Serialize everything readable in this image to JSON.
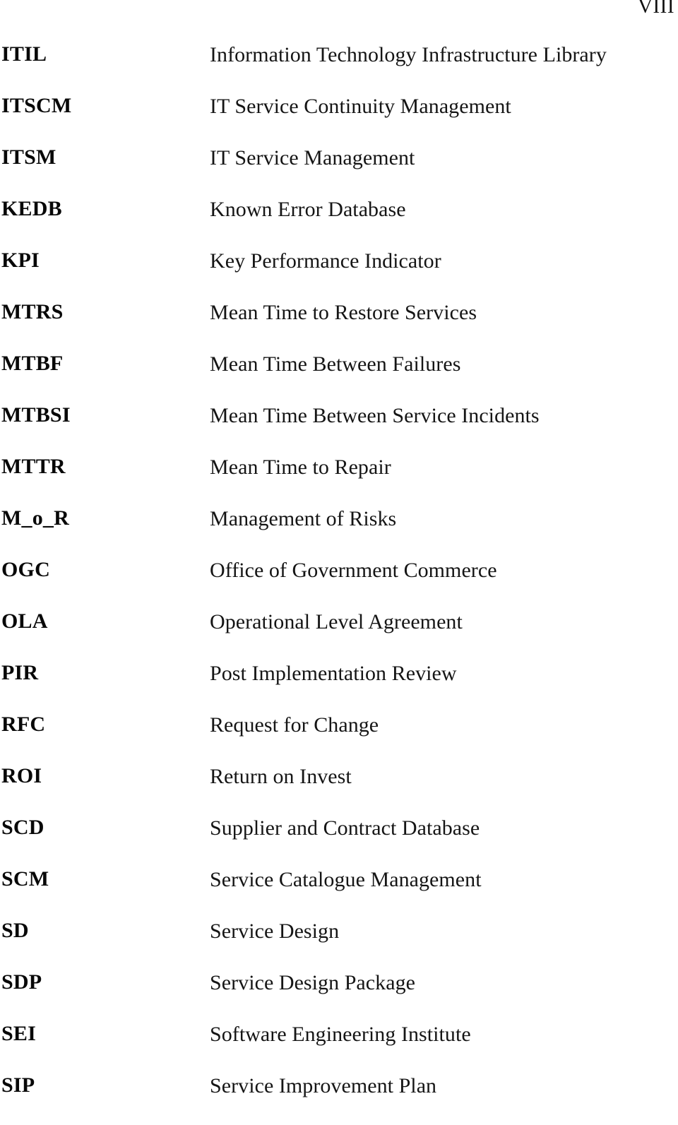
{
  "page": {
    "folio": "VIII",
    "background_color": "#ffffff",
    "text_color": "#0d0d0d"
  },
  "glossary": {
    "entries": [
      {
        "term": "ITIL",
        "definition": "Information Technology Infrastructure Library"
      },
      {
        "term": "ITSCM",
        "definition": "IT Service Continuity Management"
      },
      {
        "term": "ITSM",
        "definition": "IT Service Management"
      },
      {
        "term": "KEDB",
        "definition": "Known Error Database"
      },
      {
        "term": "KPI",
        "definition": "Key Performance Indicator"
      },
      {
        "term": "MTRS",
        "definition": "Mean Time to Restore Services"
      },
      {
        "term": "MTBF",
        "definition": "Mean Time Between Failures"
      },
      {
        "term": "MTBSI",
        "definition": "Mean Time Between Service Incidents"
      },
      {
        "term": "MTTR",
        "definition": "Mean Time to Repair"
      },
      {
        "term": "M_o_R",
        "definition": "Management of Risks"
      },
      {
        "term": "OGC",
        "definition": "Office of Government Commerce"
      },
      {
        "term": "OLA",
        "definition": "Operational Level Agreement"
      },
      {
        "term": "PIR",
        "definition": "Post Implementation Review"
      },
      {
        "term": "RFC",
        "definition": "Request for Change"
      },
      {
        "term": "ROI",
        "definition": "Return on Invest"
      },
      {
        "term": "SCD",
        "definition": "Supplier and Contract Database"
      },
      {
        "term": "SCM",
        "definition": "Service Catalogue Management"
      },
      {
        "term": "SD",
        "definition": "Service Design"
      },
      {
        "term": "SDP",
        "definition": "Service Design Package"
      },
      {
        "term": "SEI",
        "definition": "Software Engineering Institute"
      },
      {
        "term": "SIP",
        "definition": "Service Improvement Plan"
      }
    ]
  }
}
